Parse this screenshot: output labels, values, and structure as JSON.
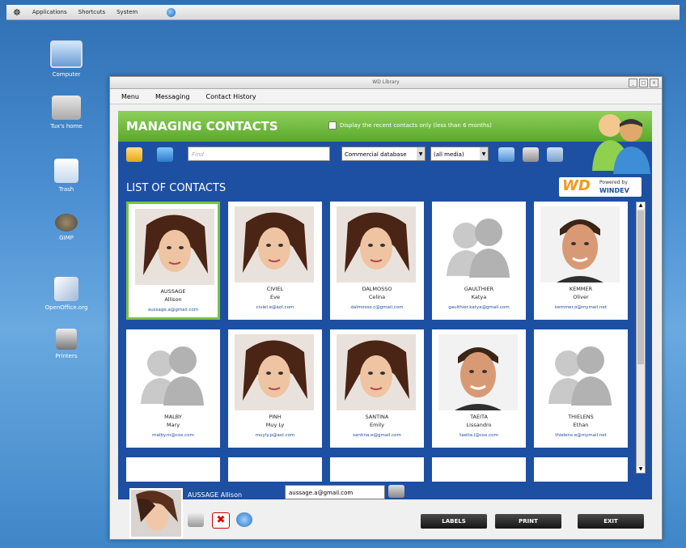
{
  "topbar": {
    "menus": [
      "Applications",
      "Shortcuts",
      "System"
    ]
  },
  "desktop": {
    "icons": [
      "Computer",
      "Tux's home",
      "Trash",
      "GIMP",
      "OpenOffice.org",
      "Printers"
    ]
  },
  "window": {
    "title": "WD Library",
    "menu": [
      "Menu",
      "Messaging",
      "Contact History"
    ]
  },
  "header": {
    "title": "MANAGING CONTACTS",
    "checkbox_label": "Display the recent contacts only (less than 6 months)"
  },
  "toolbar": {
    "find_placeholder": "Find",
    "database_select": "Commercial database",
    "media_select": "(all media)"
  },
  "list": {
    "title": "LIST OF CONTACTS",
    "contacts": [
      {
        "last": "AUSSAGE",
        "first": "Allison",
        "email": "aussage.a@gmail.com",
        "photo": "woman-photo",
        "selected": true
      },
      {
        "last": "CIVIEL",
        "first": "Eve",
        "email": "civiel.e@aol.com",
        "photo": "woman-photo"
      },
      {
        "last": "DALMOSSO",
        "first": "Celina",
        "email": "dalmosso.c@gmail.com",
        "photo": "woman-photo"
      },
      {
        "last": "GAULTHIER",
        "first": "Katya",
        "email": "gaulthier.katya@gmail.com",
        "photo": "placeholder-avatar"
      },
      {
        "last": "KEMMER",
        "first": "Oliver",
        "email": "kemmer.o@mymail.net",
        "photo": "man-photo"
      },
      {
        "last": "MALBY",
        "first": "Mary",
        "email": "malby.m@cox.com",
        "photo": "placeholder-avatar"
      },
      {
        "last": "PINH",
        "first": "Muy Ly",
        "email": "muyly.p@aol.com",
        "photo": "woman-photo"
      },
      {
        "last": "SANTINA",
        "first": "Emily",
        "email": "santina.e@gmail.com",
        "photo": "woman-photo"
      },
      {
        "last": "TAEITA",
        "first": "Lissandro",
        "email": "taeita.l@cox.com",
        "photo": "man-photo"
      },
      {
        "last": "THIELENS",
        "first": "Ethan",
        "email": "thielens.e@mymail.net",
        "photo": "placeholder-avatar"
      }
    ]
  },
  "logo": {
    "powered": "Powered by",
    "brand": "WD",
    "name": "WINDEV"
  },
  "selected": {
    "name": "AUSSAGE Allison",
    "email": "aussage.a@gmail.com"
  },
  "buttons": {
    "labels": "LABELS",
    "print": "PRINT",
    "exit": "EXIT"
  }
}
